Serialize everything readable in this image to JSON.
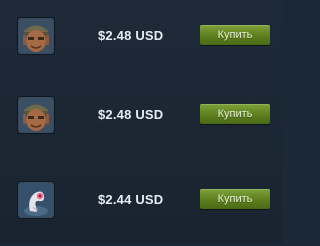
{
  "listings": [
    {
      "item_icon": "soldier-face-icon",
      "price": "$2.48 USD",
      "buy_label": "Купить"
    },
    {
      "item_icon": "soldier-face-icon",
      "price": "$2.48 USD",
      "buy_label": "Купить"
    },
    {
      "item_icon": "pink-creature-icon",
      "price": "$2.44 USD",
      "buy_label": "Купить"
    }
  ],
  "colors": {
    "background": "#1b2838",
    "button": "#5c7e1e",
    "price_text": "#e6ecf2"
  }
}
